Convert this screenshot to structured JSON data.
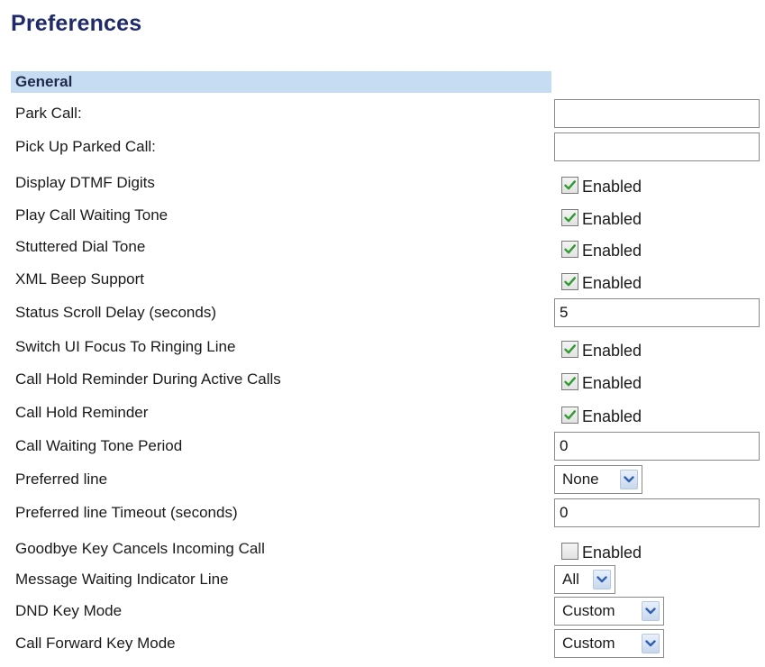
{
  "page": {
    "title": "Preferences"
  },
  "section": {
    "label": "General"
  },
  "rows": [
    {
      "label": "Park Call:",
      "type": "text",
      "value": ""
    },
    {
      "label": "Pick Up Parked Call:",
      "type": "text",
      "value": ""
    },
    {
      "label": "Display DTMF Digits",
      "type": "checkbox",
      "checked": true,
      "option_label": "Enabled"
    },
    {
      "label": "Play Call Waiting Tone",
      "type": "checkbox",
      "checked": true,
      "option_label": "Enabled"
    },
    {
      "label": "Stuttered Dial Tone",
      "type": "checkbox",
      "checked": true,
      "option_label": "Enabled"
    },
    {
      "label": "XML Beep Support",
      "type": "checkbox",
      "checked": true,
      "option_label": "Enabled"
    },
    {
      "label": "Status Scroll Delay (seconds)",
      "type": "text",
      "value": "5"
    },
    {
      "label": "Switch UI Focus To Ringing Line",
      "type": "checkbox",
      "checked": true,
      "option_label": "Enabled"
    },
    {
      "label": "Call Hold Reminder During Active Calls",
      "type": "checkbox",
      "checked": true,
      "option_label": "Enabled"
    },
    {
      "label": "Call Hold Reminder",
      "type": "checkbox",
      "checked": true,
      "option_label": "Enabled"
    },
    {
      "label": "Call Waiting Tone Period",
      "type": "text",
      "value": "0"
    },
    {
      "label": "Preferred line",
      "type": "select",
      "value": "None"
    },
    {
      "label": "Preferred line Timeout (seconds)",
      "type": "text",
      "value": "0"
    },
    {
      "label": "Goodbye Key Cancels Incoming Call",
      "type": "checkbox",
      "checked": false,
      "option_label": "Enabled"
    },
    {
      "label": "Message Waiting Indicator Line",
      "type": "select",
      "value": "All"
    },
    {
      "label": "DND Key Mode",
      "type": "select",
      "value": "Custom"
    },
    {
      "label": "Call Forward Key Mode",
      "type": "select",
      "value": "Custom"
    }
  ],
  "colors": {
    "title": "#1f2a6b",
    "section_bg": "#c6dcf2",
    "check_mark": "#2f9a2f",
    "select_arrow": "#3060b0"
  },
  "icons": {
    "checkbox_mark": "check-icon",
    "dropdown": "chevron-down-icon"
  }
}
